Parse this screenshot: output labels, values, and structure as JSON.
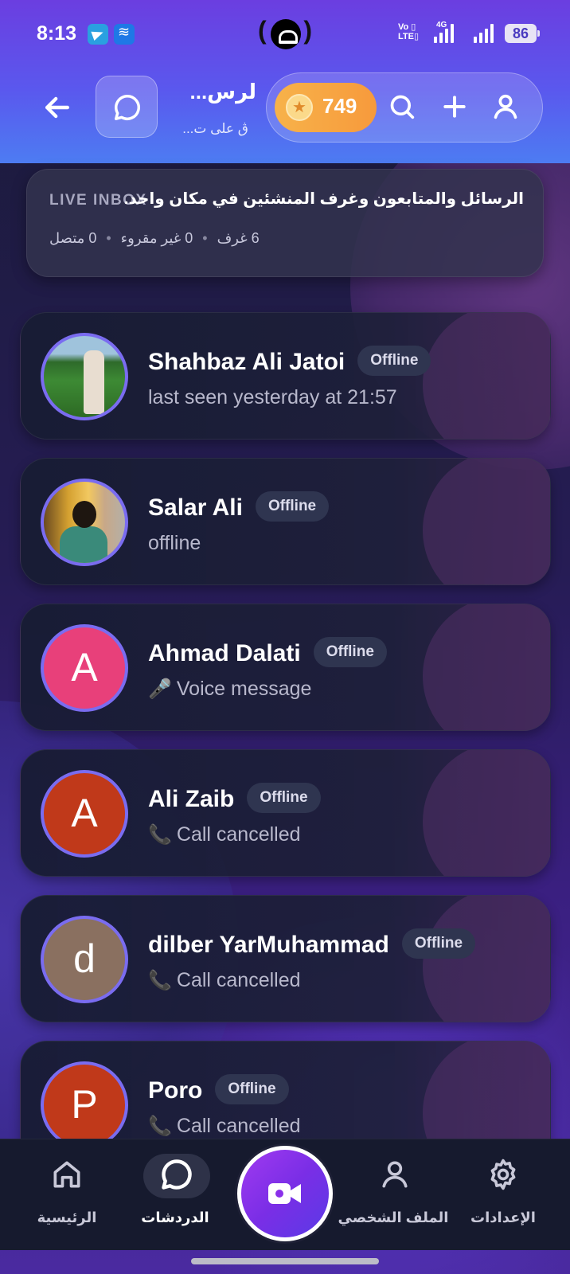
{
  "status_bar": {
    "time": "8:13",
    "network": "Vo LTE",
    "network_type": "4G",
    "battery": "86"
  },
  "header": {
    "title": "لرس...",
    "subtitle": "ڨ على ت...",
    "coins": "749",
    "icons": [
      "back-arrow-icon",
      "chat-bubble-icon",
      "star-coin-icon",
      "search-icon",
      "plus-icon",
      "user-icon"
    ]
  },
  "live_inbox": {
    "label": "LIVE INBOX",
    "description": "الرسائل والمتابعون وغرف المنشئين في مكان واحد.",
    "stats": {
      "rooms": "6 غرف",
      "unread": "0 غير مقروء",
      "online": "0 متصل"
    }
  },
  "chats": [
    {
      "name": "Shahbaz Ali Jatoi",
      "status": "Offline",
      "preview": "last seen yesterday at 21:57",
      "preview_icon": "",
      "avatar_type": "photo",
      "avatar_letter": ""
    },
    {
      "name": "Salar Ali",
      "status": "Offline",
      "preview": "offline",
      "preview_icon": "",
      "avatar_type": "photo",
      "avatar_letter": ""
    },
    {
      "name": "Ahmad Dalati",
      "status": "Offline",
      "preview": "Voice message",
      "preview_icon": "🎤",
      "avatar_type": "letter",
      "avatar_letter": "A",
      "avatar_color": "#e8407a"
    },
    {
      "name": "Ali Zaib",
      "status": "Offline",
      "preview": "Call cancelled",
      "preview_icon": "📞",
      "avatar_type": "letter",
      "avatar_letter": "A",
      "avatar_color": "#c0391a"
    },
    {
      "name": "dilber YarMuhammad",
      "status": "Offline",
      "preview": "Call cancelled",
      "preview_icon": "📞",
      "avatar_type": "letter",
      "avatar_letter": "d",
      "avatar_color": "#8a7060"
    },
    {
      "name": "Poro",
      "status": "Offline",
      "preview": "Call cancelled",
      "preview_icon": "📞",
      "avatar_type": "letter",
      "avatar_letter": "P",
      "avatar_color": "#c0391a"
    }
  ],
  "bottom_nav": {
    "home": "الرئيسية",
    "chats": "الدردشات",
    "profile": "الملف الشخصي",
    "settings": "الإعدادات"
  },
  "colors": {
    "accent": "#7a6cf0",
    "header_top": "#6b3ee0",
    "header_bottom": "#4d7cf2",
    "coin": "#f7b24a",
    "fab": "#8a30ea"
  }
}
